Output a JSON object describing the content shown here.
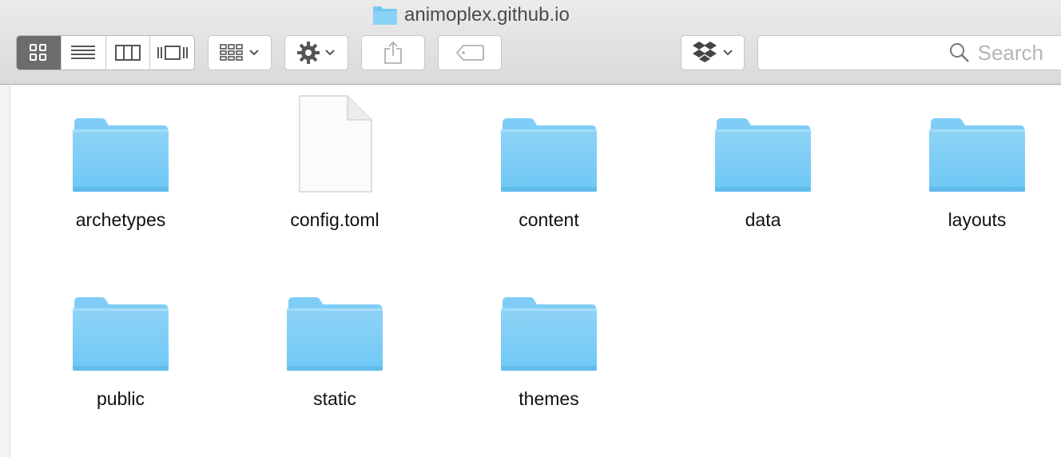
{
  "window": {
    "title": "animoplex.github.io",
    "title_icon": "folder-icon"
  },
  "toolbar": {
    "view_buttons": [
      {
        "name": "icon-view",
        "icon": "grid-icon",
        "selected": true
      },
      {
        "name": "list-view",
        "icon": "list-icon",
        "selected": false
      },
      {
        "name": "column-view",
        "icon": "columns-icon",
        "selected": false
      },
      {
        "name": "cover-flow-view",
        "icon": "cover-flow-icon",
        "selected": false
      }
    ],
    "arrange_icon": "arrange-grid-icon",
    "action_icon": "gear-icon",
    "share_icon": "share-icon",
    "tags_icon": "tag-icon",
    "dropbox_icon": "dropbox-icon",
    "search": {
      "placeholder": "Search"
    }
  },
  "colors": {
    "folder_top": "#8fd3f7",
    "folder_bottom": "#6ec8f5",
    "folder_tab": "#7fcdf6",
    "selected_segment": "#6c6c6c"
  },
  "items": [
    {
      "label": "archetypes",
      "kind": "folder"
    },
    {
      "label": "config.toml",
      "kind": "file"
    },
    {
      "label": "content",
      "kind": "folder"
    },
    {
      "label": "data",
      "kind": "folder"
    },
    {
      "label": "layouts",
      "kind": "folder"
    },
    {
      "label": "public",
      "kind": "folder"
    },
    {
      "label": "static",
      "kind": "folder"
    },
    {
      "label": "themes",
      "kind": "folder"
    }
  ]
}
